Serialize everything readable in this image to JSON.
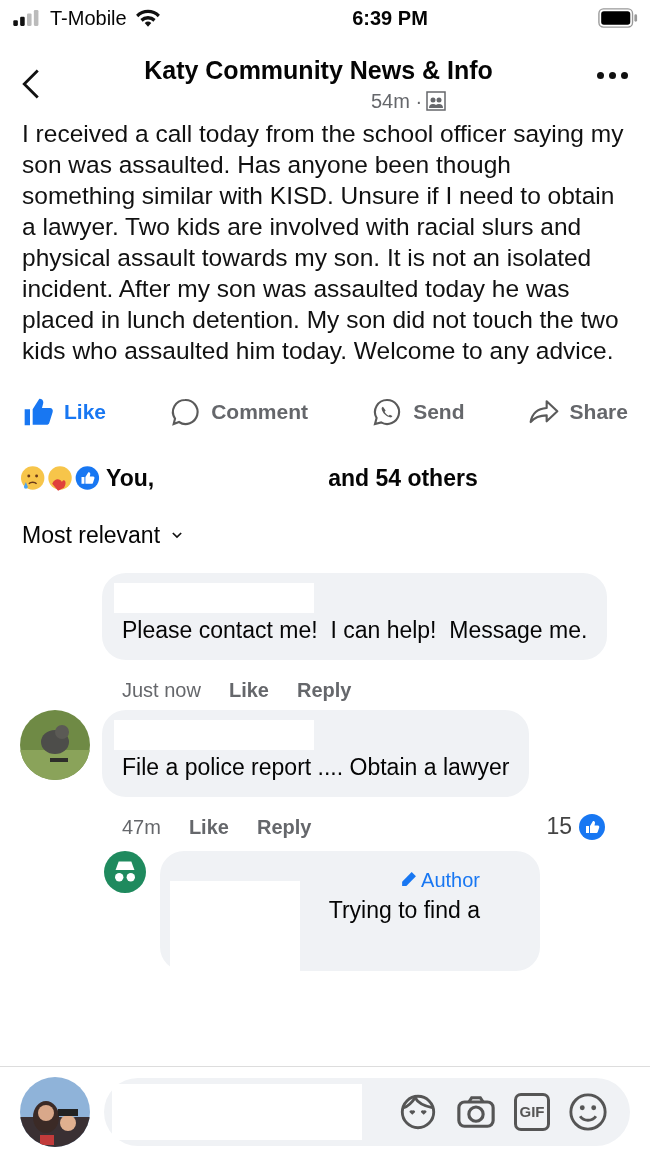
{
  "status_bar": {
    "carrier": "T-Mobile",
    "time": "6:39 PM"
  },
  "header": {
    "title": "Katy Community News & Info",
    "time": "54m ·"
  },
  "post": {
    "text": "I received a call today from the school officer saying my son was assaulted. Has anyone been though something similar with KISD. Unsure if I need to obtain a lawyer. Two kids are involved with racial slurs and physical assault towards my son. It is not an isolated incident. After my son was assaulted today he was placed in lunch detention. My son did not touch the two kids who assaulted him today. Welcome to any advice."
  },
  "actions": [
    {
      "kind": "like",
      "label": "Like",
      "selected": true
    },
    {
      "kind": "comment",
      "label": "Comment",
      "selected": false
    },
    {
      "kind": "send",
      "label": "Send",
      "selected": false
    },
    {
      "kind": "share",
      "label": "Share",
      "selected": false
    }
  ],
  "reactions": {
    "first": "You,",
    "rest": "and 54 others"
  },
  "sort": {
    "label": "Most relevant"
  },
  "comments": [
    {
      "text": "Please contact me!  I can help!  Message me.",
      "time": "Just now",
      "like": "Like",
      "reply": "Reply"
    },
    {
      "avatar": {
        "kind": "picture"
      },
      "text": "File a police report .... Obtain a lawyer",
      "time": "47m",
      "like": "Like",
      "reply": "Reply",
      "count": "15",
      "replies": [
        {
          "avatar": {
            "kind": "anonymous"
          },
          "badge": "Author",
          "text": "Trying to find a"
        }
      ]
    }
  ],
  "composer": {
    "gif": "GIF"
  }
}
